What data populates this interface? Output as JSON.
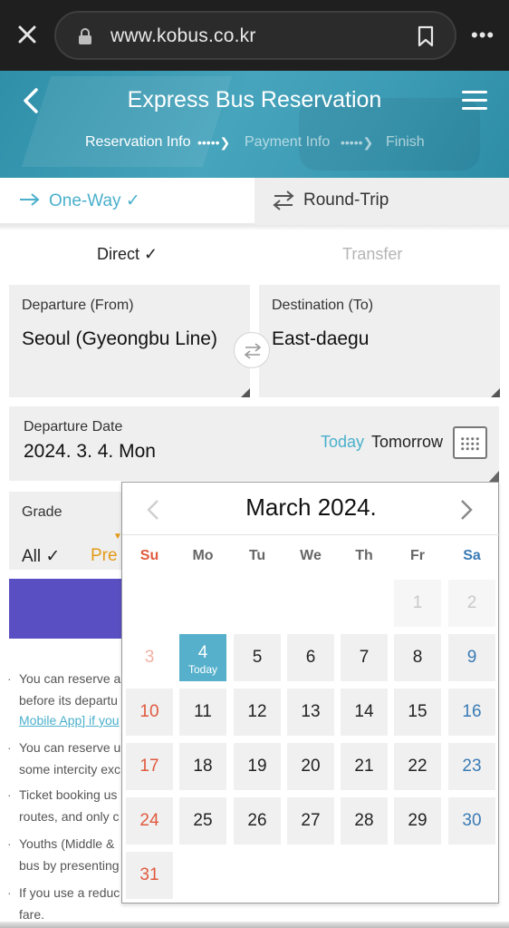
{
  "browser": {
    "url": "www.kobus.co.kr",
    "icons": [
      "close-icon",
      "lock-icon",
      "bookmark-icon",
      "more-icon"
    ]
  },
  "header": {
    "title": "Express Bus Reservation",
    "steps": [
      "Reservation Info",
      "Payment Info",
      "Finish"
    ],
    "icons": [
      "back-icon",
      "menu-icon"
    ]
  },
  "trip_tabs": {
    "one_way": "One-Way ✓",
    "round_trip": "Round-Trip"
  },
  "route_type": {
    "direct": "Direct ✓",
    "transfer": "Transfer"
  },
  "departure": {
    "label": "Departure (From)",
    "value": "Seoul (Gyeongbu Line)"
  },
  "destination": {
    "label": "Destination (To)",
    "value": "East-daegu"
  },
  "date": {
    "label": "Departure Date",
    "value": "2024. 3. 4. Mon",
    "today": "Today",
    "tomorrow": "Tomorrow"
  },
  "grade": {
    "label": "Grade",
    "all": "All ✓",
    "premium": "Pre"
  },
  "notices": [
    {
      "line1": "You can reserve a",
      "line2": "before its departu"
    },
    {
      "line1": "Mobile App] if you",
      "line2": ""
    },
    {
      "line1": "You can reserve u",
      "line2": "some intercity exc"
    },
    {
      "line1": "Ticket booking us",
      "line2": "routes, and only c"
    },
    {
      "line1": "Youths (Middle &",
      "line2": "bus by presenting"
    },
    {
      "line1": "If you use a reduc",
      "line2": "fare."
    }
  ],
  "calendar": {
    "title": "March 2024.",
    "weekdays": [
      "Su",
      "Mo",
      "Tu",
      "We",
      "Th",
      "Fr",
      "Sa"
    ],
    "today_label": "Today",
    "days": {
      "d1": "1",
      "d2": "2",
      "d3": "3",
      "d4": "4",
      "d5": "5",
      "d6": "6",
      "d7": "7",
      "d8": "8",
      "d9": "9",
      "d10": "10",
      "d11": "11",
      "d12": "12",
      "d13": "13",
      "d14": "14",
      "d15": "15",
      "d16": "16",
      "d17": "17",
      "d18": "18",
      "d19": "19",
      "d20": "20",
      "d21": "21",
      "d22": "22",
      "d23": "23",
      "d24": "24",
      "d25": "25",
      "d26": "26",
      "d27": "27",
      "d28": "28",
      "d29": "29",
      "d30": "30",
      "d31": "31"
    }
  },
  "colors": {
    "accent": "#4ab0cc",
    "header": "#3d9cb5",
    "sunday": "#e05a3e",
    "saturday": "#3a7bb5",
    "search_button": "#5a4fc2",
    "premium": "#e39a17"
  }
}
